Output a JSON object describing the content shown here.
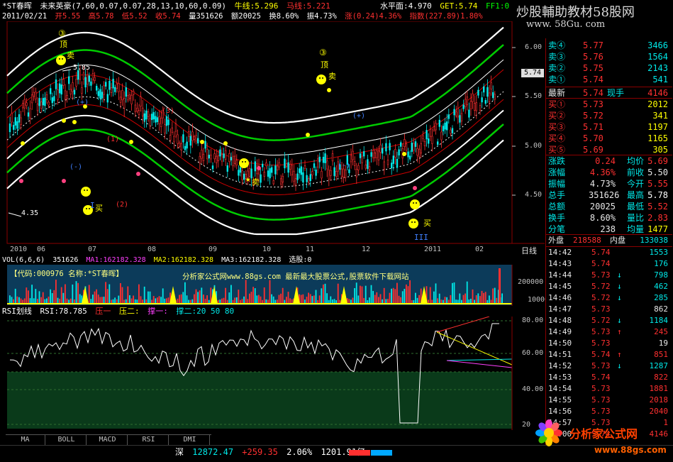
{
  "header": {
    "name": "*ST春晖",
    "formula": "未来英豪(7,60,0.07,0.07,28,13,10,60,0.09)",
    "niu_label": "牛线:5.296",
    "ma_label": "马线:5.221",
    "horizon": "水平面:4.970",
    "get": "GET:5.74",
    "ff": "FF1:0"
  },
  "ohlc": {
    "date": "2011/02/21",
    "open": "开5.55",
    "high": "高5.78",
    "low": "低5.52",
    "close": "收5.74",
    "volume": "量351626",
    "amount": "额20025",
    "turnover": "换8.60%",
    "amplitude": "振4.73%",
    "change": "涨(0.24)4.36%",
    "index": "指数(227.89)1.80%"
  },
  "watermark": {
    "site_title": "炒股輔助教材58股网",
    "url": "www. 58Gu. com",
    "fx_logo": "分析家公式网",
    "fx_url": "www.88gs.com"
  },
  "price_axis": {
    "ticks": [
      "6.00",
      "5.50",
      "5.00",
      "4.50"
    ],
    "current": "5.74"
  },
  "annotations": {
    "top_mark": "③",
    "top_label": "顶",
    "sell": "卖",
    "buy": "买",
    "high_price": "5.85",
    "low_price": "4.35",
    "wave_I": "I",
    "wave_III": "III",
    "circ1": "(1)",
    "circ2": "(2)",
    "circ3": "(3)",
    "circm": "(-)",
    "circ_plus": "(+)",
    "p_marks": [
      "P",
      "P",
      "P"
    ]
  },
  "date_axis": {
    "labels": [
      "2010",
      "06",
      "07",
      "08",
      "09",
      "10",
      "11",
      "12",
      "2011",
      "02"
    ],
    "period": "日线"
  },
  "volume_panel": {
    "title": "VOL(6,6,6)",
    "value": "351626",
    "ma1": "MA1:162182.328",
    "ma2": "MA2:162182.328",
    "ma3": "MA3:162182.328",
    "stock_pick": "选股:0",
    "info_text": "【代码:000976 名称:*ST春晖】",
    "banner_text": "分析家公式网www.88gs.com 最新最大股票公式,股票软件下载网站",
    "axis_ticks": [
      "200000",
      "10000"
    ]
  },
  "rsi_panel": {
    "title": "RSI划线",
    "rsi": "RSI:78.785",
    "press1": "压一",
    "press2": "压二:",
    "support1": "撑一:",
    "support2": "撑二:20 50 80",
    "axis_ticks": [
      "80.00",
      "60.00",
      "40.00",
      "20"
    ]
  },
  "tabs": [
    "MA",
    "BOLL",
    "MACD",
    "RSI",
    "DMI"
  ],
  "status_bar": {
    "market": "深",
    "index": "12872.47",
    "change": "+259.35",
    "pct": "2.06%",
    "amount": "1201.91亿"
  },
  "order_book": {
    "asks": [
      {
        "label": "卖④",
        "price": "5.77",
        "vol": "3466"
      },
      {
        "label": "卖③",
        "price": "5.76",
        "vol": "1564"
      },
      {
        "label": "卖②",
        "price": "5.75",
        "vol": "2143"
      },
      {
        "label": "卖①",
        "price": "5.74",
        "vol": "541"
      }
    ],
    "last": {
      "label": "最新",
      "price": "5.74",
      "label2": "现手",
      "vol": "4146"
    },
    "bids": [
      {
        "label": "买①",
        "price": "5.73",
        "vol": "2012"
      },
      {
        "label": "买②",
        "price": "5.72",
        "vol": "341"
      },
      {
        "label": "买③",
        "price": "5.71",
        "vol": "1197"
      },
      {
        "label": "买④",
        "price": "5.70",
        "vol": "1165"
      },
      {
        "label": "买⑤",
        "price": "5.69",
        "vol": "305"
      }
    ]
  },
  "stats": [
    {
      "l1": "涨跌",
      "v1": "0.24",
      "l2": "均价",
      "v2": "5.69",
      "c1": "#ff3030",
      "c2": "#ff3030"
    },
    {
      "l1": "涨幅",
      "v1": "4.36%",
      "l2": "前收",
      "v2": "5.50",
      "c1": "#ff3030",
      "c2": "#e8e8e8"
    },
    {
      "l1": "振幅",
      "v1": "4.73%",
      "l2": "今开",
      "v2": "5.55",
      "c1": "#e8e8e8",
      "c2": "#ff3030"
    },
    {
      "l1": "总手",
      "v1": "351626",
      "l2": "最高",
      "v2": "5.78",
      "c1": "#e8e8e8",
      "c2": "#ffffff"
    },
    {
      "l1": "总额",
      "v1": "20025",
      "l2": "最低",
      "v2": "5.52",
      "c1": "#e8e8e8",
      "c2": "#ff3030"
    },
    {
      "l1": "换手",
      "v1": "8.60%",
      "l2": "量比",
      "v2": "2.83",
      "c1": "#e8e8e8",
      "c2": "#ff3030"
    },
    {
      "l1": "分笔",
      "v1": "238",
      "l2": "均量",
      "v2": "1477",
      "c1": "#e8e8e8",
      "c2": "#ffff00"
    }
  ],
  "outer_inner": {
    "out_label": "外盘",
    "out": "218588",
    "in_label": "内盘",
    "in": "133038"
  },
  "ticks": [
    {
      "t": "14:42",
      "p": "5.74",
      "a": "",
      "v": "1553",
      "pc": "#ff3030",
      "vc": "#00e8e8"
    },
    {
      "t": "14:43",
      "p": "5.74",
      "a": "",
      "v": "176",
      "pc": "#ff3030",
      "vc": "#00e8e8"
    },
    {
      "t": "14:44",
      "p": "5.73",
      "a": "↓",
      "v": "798",
      "pc": "#ff3030",
      "vc": "#00e8e8"
    },
    {
      "t": "14:45",
      "p": "5.72",
      "a": "↓",
      "v": "462",
      "pc": "#ff3030",
      "vc": "#00e8e8"
    },
    {
      "t": "14:46",
      "p": "5.72",
      "a": "↓",
      "v": "285",
      "pc": "#ff3030",
      "vc": "#00e8e8"
    },
    {
      "t": "14:47",
      "p": "5.73",
      "a": "",
      "v": "862",
      "pc": "#ff3030",
      "vc": "#e8e8e8"
    },
    {
      "t": "14:48",
      "p": "5.72",
      "a": "↓",
      "v": "1184",
      "pc": "#ff3030",
      "vc": "#00e8e8"
    },
    {
      "t": "14:49",
      "p": "5.73",
      "a": "↑",
      "v": "245",
      "pc": "#ff3030",
      "vc": "#ff3030"
    },
    {
      "t": "14:50",
      "p": "5.73",
      "a": "",
      "v": "19",
      "pc": "#ff3030",
      "vc": "#e8e8e8"
    },
    {
      "t": "14:51",
      "p": "5.74",
      "a": "↑",
      "v": "851",
      "pc": "#ff3030",
      "vc": "#ff3030"
    },
    {
      "t": "14:52",
      "p": "5.73",
      "a": "↓",
      "v": "1287",
      "pc": "#ff3030",
      "vc": "#00e8e8"
    },
    {
      "t": "14:53",
      "p": "5.74",
      "a": "",
      "v": "822",
      "pc": "#ff3030",
      "vc": "#ff3030"
    },
    {
      "t": "14:54",
      "p": "5.73",
      "a": "",
      "v": "1881",
      "pc": "#ff3030",
      "vc": "#ff3030"
    },
    {
      "t": "14:55",
      "p": "5.73",
      "a": "",
      "v": "2018",
      "pc": "#ff3030",
      "vc": "#ff3030"
    },
    {
      "t": "14:56",
      "p": "5.73",
      "a": "",
      "v": "2040",
      "pc": "#ff3030",
      "vc": "#ff3030"
    },
    {
      "t": "14:57",
      "p": "5.73",
      "a": "",
      "v": "1",
      "pc": "#ff3030",
      "vc": "#ff3030"
    },
    {
      "t": "15:00",
      "p": "5.74",
      "a": "",
      "v": "4146",
      "pc": "#ff3030",
      "vc": "#ff3030"
    }
  ],
  "colors": {
    "up": "#ff3030",
    "down": "#00e8e8",
    "band": "#ffffff",
    "band2": "#00cc00",
    "rsi_bg": "#0a3a1a"
  }
}
